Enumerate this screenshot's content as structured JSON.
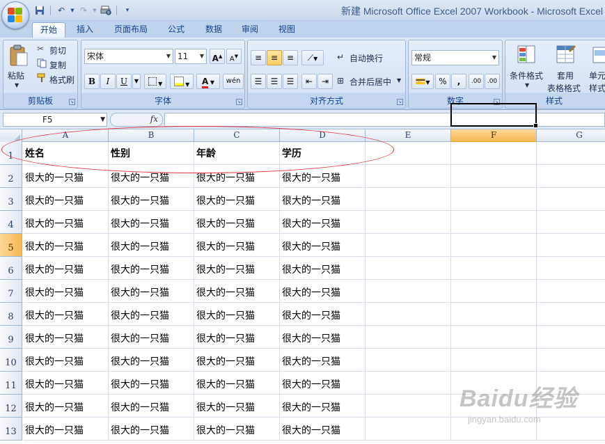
{
  "window": {
    "title": "新建 Microsoft Office Excel 2007 Workbook - Microsoft Excel"
  },
  "ribbon_tabs": [
    "开始",
    "插入",
    "页面布局",
    "公式",
    "数据",
    "审阅",
    "视图"
  ],
  "clipboard": {
    "paste": "粘贴",
    "cut": "剪切",
    "copy": "复制",
    "format_painter": "格式刷",
    "label": "剪贴板"
  },
  "font": {
    "name": "宋体",
    "size": "11",
    "grow": "A",
    "shrink": "A",
    "bold": "B",
    "italic": "I",
    "underline": "U",
    "phonetic": "wén",
    "label": "字体"
  },
  "alignment": {
    "wrap_text": "自动换行",
    "merge_center": "合并后居中",
    "label": "对齐方式"
  },
  "number": {
    "format": "常规",
    "percent": "%",
    "comma": ",",
    "inc_decimal": ".00",
    "dec_decimal": ".00",
    "label": "数字"
  },
  "styles": {
    "conditional_format": "条件格式",
    "table_format_line1": "套用",
    "table_format_line2": "表格格式",
    "cell_styles_line1": "单元",
    "cell_styles_line2": "样式",
    "label": "样式"
  },
  "formula_bar": {
    "name_box": "F5",
    "fx": "fx",
    "content": ""
  },
  "columns": [
    "A",
    "B",
    "C",
    "D",
    "E",
    "F",
    "G"
  ],
  "selected_column": "F",
  "selected_row": 5,
  "row_numbers": [
    "1",
    "2",
    "3",
    "4",
    "5",
    "6",
    "7",
    "8",
    "9",
    "10",
    "11",
    "12",
    "13"
  ],
  "headers": [
    "姓名",
    "性别",
    "年龄",
    "学历"
  ],
  "cell_value": "很大的一只猫",
  "data_rows": 12,
  "watermark": {
    "logo": "Baidu经验",
    "sub": "jingyan.baidu.com"
  },
  "colors": {
    "annotation": "#e0313b",
    "selected_header": "#f6b752",
    "tab_text": "#15428b"
  }
}
